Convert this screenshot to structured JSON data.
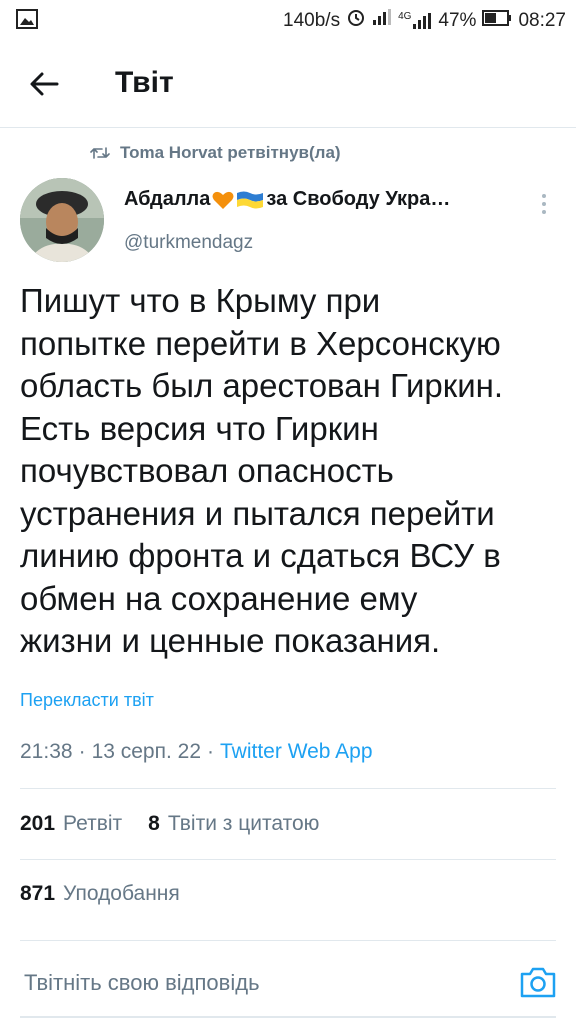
{
  "status_bar": {
    "speed": "140b/s",
    "network": "4G",
    "battery": "47%",
    "time": "08:27",
    "icons": [
      "image-icon",
      "alarm-icon",
      "signal-icon",
      "signal-4g-icon",
      "battery-icon"
    ]
  },
  "header": {
    "title": "Твіт",
    "back_icon": "arrow-left-icon"
  },
  "retweet": {
    "text": "Toma Horvat ретвітнув(ла)",
    "icon": "retweet-icon"
  },
  "author": {
    "name_part1": "Абдалла",
    "name_part2": "за Свободу Укра…",
    "emojis": [
      "orange-heart-icon",
      "ukraine-flag-icon"
    ],
    "handle": "@turkmendagz"
  },
  "tweet": {
    "lines": [
      "Пишут что в Крыму при",
      "попытке перейти в Херсонскую",
      "область был арестован Гиркин.",
      "Есть версия что Гиркин",
      "почувствовал опасность",
      "устранения и пытался перейти",
      "линию фронта и сдаться ВСУ в",
      "обмен на сохранение ему",
      "жизни и ценные показания."
    ],
    "translate": "Перекласти твіт"
  },
  "meta": {
    "time": "21:38",
    "sep1": "·",
    "date": "13 серп. 22",
    "sep2": "·",
    "source": "Twitter Web App"
  },
  "stats": {
    "retweets_count": "201",
    "retweets_label": "Ретвіт",
    "quotes_count": "8",
    "quotes_label": "Твіти з цитатою",
    "likes_count": "871",
    "likes_label": "Уподобання"
  },
  "reply": {
    "placeholder": "Твітніть свою відповідь",
    "camera_icon": "camera-icon"
  },
  "colors": {
    "accent": "#1da1f2",
    "secondary_text": "#657786",
    "divider": "#e1e8ed",
    "heart": "#f4900c",
    "flag_blue": "#2d7dd2",
    "flag_yellow": "#fdd835"
  }
}
